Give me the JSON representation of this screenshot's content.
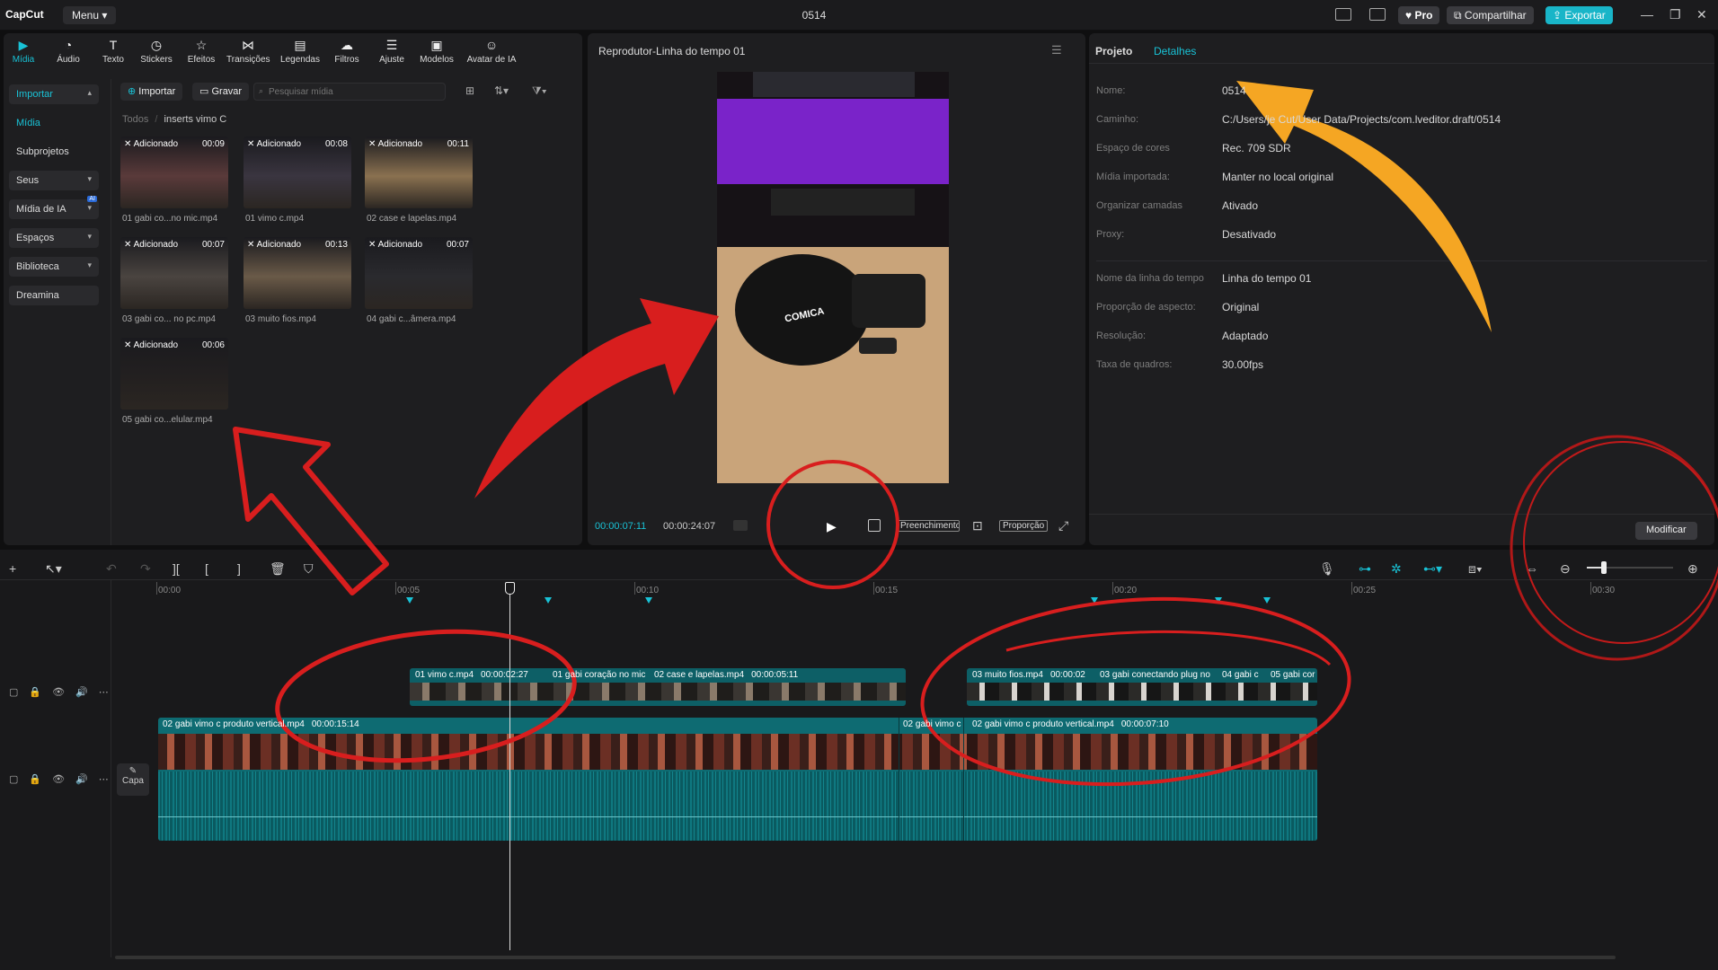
{
  "app": {
    "logo": "CapCut",
    "menu": "Menu",
    "title": "0514"
  },
  "topbar": {
    "pro": "Pro",
    "share": "Compartilhar",
    "export": "Exportar"
  },
  "tools": [
    {
      "label": "Mídia",
      "icon": "media-icon"
    },
    {
      "label": "Áudio",
      "icon": "audio-icon"
    },
    {
      "label": "Texto",
      "icon": "text-icon"
    },
    {
      "label": "Stickers",
      "icon": "sticker-icon"
    },
    {
      "label": "Efeitos",
      "icon": "effects-icon"
    },
    {
      "label": "Transições",
      "icon": "transitions-icon"
    },
    {
      "label": "Legendas",
      "icon": "captions-icon"
    },
    {
      "label": "Filtros",
      "icon": "filters-icon"
    },
    {
      "label": "Ajuste",
      "icon": "adjust-icon"
    },
    {
      "label": "Modelos",
      "icon": "templates-icon"
    },
    {
      "label": "Avatar de IA",
      "icon": "avatar-icon"
    }
  ],
  "nav": {
    "import": "Importar",
    "media": "Mídia",
    "subprojects": "Subprojetos",
    "yours": "Seus",
    "ai_media": "Mídia de IA",
    "ai_badge": "AI",
    "spaces": "Espaços",
    "library": "Biblioteca",
    "dreamina": "Dreamina"
  },
  "media_toolbar": {
    "import": "Importar",
    "record": "Gravar",
    "search_placeholder": "Pesquisar mídia"
  },
  "breadcrumb": {
    "all": "Todos",
    "sep": "/",
    "folder": "inserts vimo C"
  },
  "media": [
    {
      "tag": "Adicionado",
      "duration": "00:09",
      "name": "01 gabi co...no mic.mp4"
    },
    {
      "tag": "Adicionado",
      "duration": "00:08",
      "name": "01 vimo c.mp4"
    },
    {
      "tag": "Adicionado",
      "duration": "00:11",
      "name": "02 case e lapelas.mp4"
    },
    {
      "tag": "Adicionado",
      "duration": "00:07",
      "name": "03 gabi co... no pc.mp4"
    },
    {
      "tag": "Adicionado",
      "duration": "00:13",
      "name": "03 muito fios.mp4"
    },
    {
      "tag": "Adicionado",
      "duration": "00:07",
      "name": "04 gabi c...âmera.mp4"
    },
    {
      "tag": "Adicionado",
      "duration": "00:06",
      "name": "05 gabi co...elular.mp4"
    }
  ],
  "player": {
    "title": "Reprodutor-Linha do tempo 01",
    "current": "00:00:07:11",
    "total": "00:00:24:07",
    "fill": "Preenchimento",
    "ratio": "Proporção",
    "brand": "COMICA"
  },
  "details": {
    "tab_project": "Projeto",
    "tab_details": "Detalhes",
    "rows": [
      {
        "label": "Nome:",
        "value": "0514"
      },
      {
        "label": "Caminho:",
        "value": "C:/Users/je                          Cut/User Data/Projects/com.lveditor.draft/0514"
      },
      {
        "label": "Espaço de cores",
        "value": "Rec. 709 SDR"
      },
      {
        "label": "Mídia importada:",
        "value": "Manter no local original"
      },
      {
        "label": "Organizar camadas",
        "value": "Ativado"
      },
      {
        "label": "Proxy:",
        "value": "Desativado"
      },
      {
        "label": "Nome da linha do tempo",
        "value": "Linha do tempo 01"
      },
      {
        "label": "Proporção de aspecto:",
        "value": "Original"
      },
      {
        "label": "Resolução:",
        "value": "Adaptado"
      },
      {
        "label": "Taxa de quadros:",
        "value": "30.00fps"
      }
    ],
    "modify": "Modificar"
  },
  "timeline": {
    "ticks": [
      "00:00",
      "00:05",
      "00:10",
      "00:15",
      "00:20",
      "00:25",
      "00:30"
    ],
    "cover": "Capa",
    "overlay_clips": [
      {
        "name": "01 vimo c.mp4",
        "dur": "00:00:02:27"
      },
      {
        "name": "01 gabi coração no mic",
        "dur": ""
      },
      {
        "name": "02 case e lapelas.mp4",
        "dur": "00:00:05:11"
      },
      {
        "name": "03 muito fios.mp4",
        "dur": "00:00:02"
      },
      {
        "name": "03 gabi conectando plug no",
        "dur": ""
      },
      {
        "name": "04 gabi c",
        "dur": ""
      },
      {
        "name": "05 gabi cor",
        "dur": ""
      }
    ],
    "main_clips": [
      {
        "name": "02 gabi vimo c produto vertical.mp4",
        "dur": "00:00:15:14"
      },
      {
        "name": "02 gabi vimo c",
        "dur": ""
      },
      {
        "name": "02 gabi vimo c produto vertical.mp4",
        "dur": "00:00:07:10"
      }
    ]
  },
  "colors": {
    "accent": "#19c2d6",
    "annotation_red": "#d81e1e",
    "annotation_orange": "#f5a623",
    "clip_teal": "#0e6b72"
  }
}
